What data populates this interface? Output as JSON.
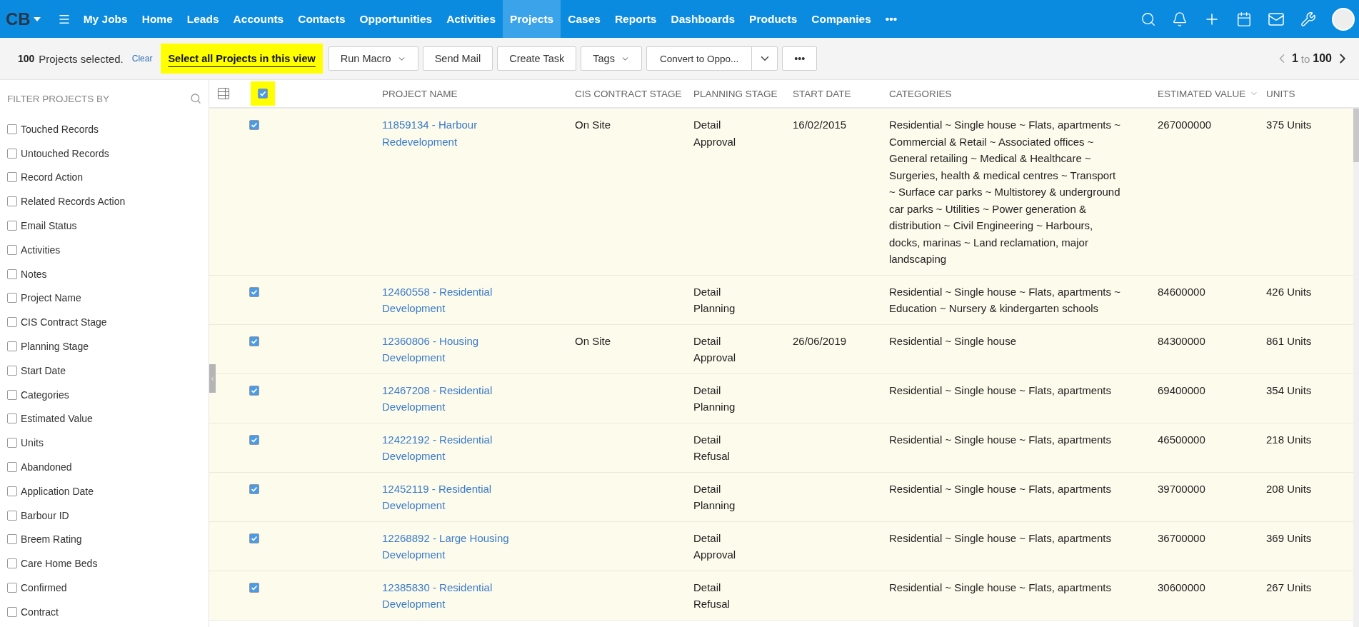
{
  "nav": {
    "logo": "CB",
    "items": [
      {
        "label": "My Jobs",
        "selected": false
      },
      {
        "label": "Home",
        "selected": false
      },
      {
        "label": "Leads",
        "selected": false
      },
      {
        "label": "Accounts",
        "selected": false
      },
      {
        "label": "Contacts",
        "selected": false
      },
      {
        "label": "Opportunities",
        "selected": false
      },
      {
        "label": "Activities",
        "selected": false
      },
      {
        "label": "Projects",
        "selected": true
      },
      {
        "label": "Cases",
        "selected": false
      },
      {
        "label": "Reports",
        "selected": false
      },
      {
        "label": "Dashboards",
        "selected": false
      },
      {
        "label": "Products",
        "selected": false
      },
      {
        "label": "Companies",
        "selected": false
      }
    ],
    "more": "•••"
  },
  "toolbar": {
    "count": "100",
    "selected_text": "Projects selected.",
    "clear": "Clear",
    "select_all": "Select all Projects in this view",
    "buttons": [
      {
        "label": "Run Macro",
        "kind": "dropdown"
      },
      {
        "label": "Send Mail",
        "kind": "plain"
      },
      {
        "label": "Create Task",
        "kind": "plain"
      },
      {
        "label": "Tags",
        "kind": "dropdown"
      },
      {
        "label": "Convert to Oppo...",
        "kind": "split"
      },
      {
        "label": "•••",
        "kind": "plain"
      }
    ],
    "pagination": {
      "from": "1",
      "to_word": "to",
      "to": "100"
    }
  },
  "sidebar": {
    "title": "FILTER PROJECTS BY",
    "items": [
      {
        "label": "Touched Records",
        "checked": false
      },
      {
        "label": "Untouched Records",
        "checked": false
      },
      {
        "label": "Record Action",
        "checked": false
      },
      {
        "label": "Related Records Action",
        "checked": false
      },
      {
        "label": "Email Status",
        "checked": false
      },
      {
        "label": "Activities",
        "checked": false
      },
      {
        "label": "Notes",
        "checked": false
      },
      {
        "label": "Project Name",
        "checked": false
      },
      {
        "label": "CIS Contract Stage",
        "checked": false
      },
      {
        "label": "Planning Stage",
        "checked": false
      },
      {
        "label": "Start Date",
        "checked": false
      },
      {
        "label": "Categories",
        "checked": false
      },
      {
        "label": "Estimated Value",
        "checked": false
      },
      {
        "label": "Units",
        "checked": false
      },
      {
        "label": "Abandoned",
        "checked": false
      },
      {
        "label": "Application Date",
        "checked": false
      },
      {
        "label": "Barbour ID",
        "checked": false
      },
      {
        "label": "Breem Rating",
        "checked": false
      },
      {
        "label": "Care Home Beds",
        "checked": false
      },
      {
        "label": "Confirmed",
        "checked": false
      },
      {
        "label": "Contract",
        "checked": false
      }
    ]
  },
  "table": {
    "all_checked": true,
    "columns": [
      {
        "label": "PROJECT NAME",
        "sorted": false
      },
      {
        "label": "CIS CONTRACT STAGE",
        "sorted": false
      },
      {
        "label": "PLANNING STAGE",
        "sorted": false
      },
      {
        "label": "START DATE",
        "sorted": false
      },
      {
        "label": "CATEGORIES",
        "sorted": false
      },
      {
        "label": "ESTIMATED VALUE",
        "sorted": true
      },
      {
        "label": "UNITS",
        "sorted": false
      }
    ],
    "rows": [
      {
        "checked": true,
        "cells": [
          "11859134 - Harbour Redevelopment",
          "On Site",
          "Detail Approval",
          "16/02/2015",
          "Residential ~ Single house ~ Flats, apartments ~ Commercial & Retail ~ Associated offices ~ General retailing ~ Medical & Healthcare ~ Surgeries, health & medical centres ~ Transport ~ Surface car parks ~ Multistorey & underground car parks ~ Utilities ~ Power generation & distribution ~ Civil Engineering ~ Harbours, docks, marinas ~ Land reclamation, major landscaping",
          "267000000",
          "375 Units"
        ]
      },
      {
        "checked": true,
        "cells": [
          "12460558 - Residential Development",
          "",
          "Detail Planning",
          "",
          "Residential ~ Single house ~ Flats, apartments ~ Education ~ Nursery & kindergarten schools",
          "84600000",
          "426 Units"
        ]
      },
      {
        "checked": true,
        "cells": [
          "12360806 - Housing Development",
          "On Site",
          "Detail Approval",
          "26/06/2019",
          "Residential ~ Single house",
          "84300000",
          "861 Units"
        ]
      },
      {
        "checked": true,
        "cells": [
          "12467208 - Residential Development",
          "",
          "Detail Planning",
          "",
          "Residential ~ Single house ~ Flats, apartments",
          "69400000",
          "354 Units"
        ]
      },
      {
        "checked": true,
        "cells": [
          "12422192 - Residential Development",
          "",
          "Detail Refusal",
          "",
          "Residential ~ Single house ~ Flats, apartments",
          "46500000",
          "218 Units"
        ]
      },
      {
        "checked": true,
        "cells": [
          "12452119 - Residential Development",
          "",
          "Detail Planning",
          "",
          "Residential ~ Single house ~ Flats, apartments",
          "39700000",
          "208 Units"
        ]
      },
      {
        "checked": true,
        "cells": [
          "12268892 - Large Housing Development",
          "",
          "Detail Approval",
          "",
          "Residential ~ Single house ~ Flats, apartments",
          "36700000",
          "369 Units"
        ]
      },
      {
        "checked": true,
        "cells": [
          "12385830 - Residential Development",
          "",
          "Detail Refusal",
          "",
          "Residential ~ Single house ~ Flats, apartments",
          "30600000",
          "267 Units"
        ]
      }
    ]
  }
}
